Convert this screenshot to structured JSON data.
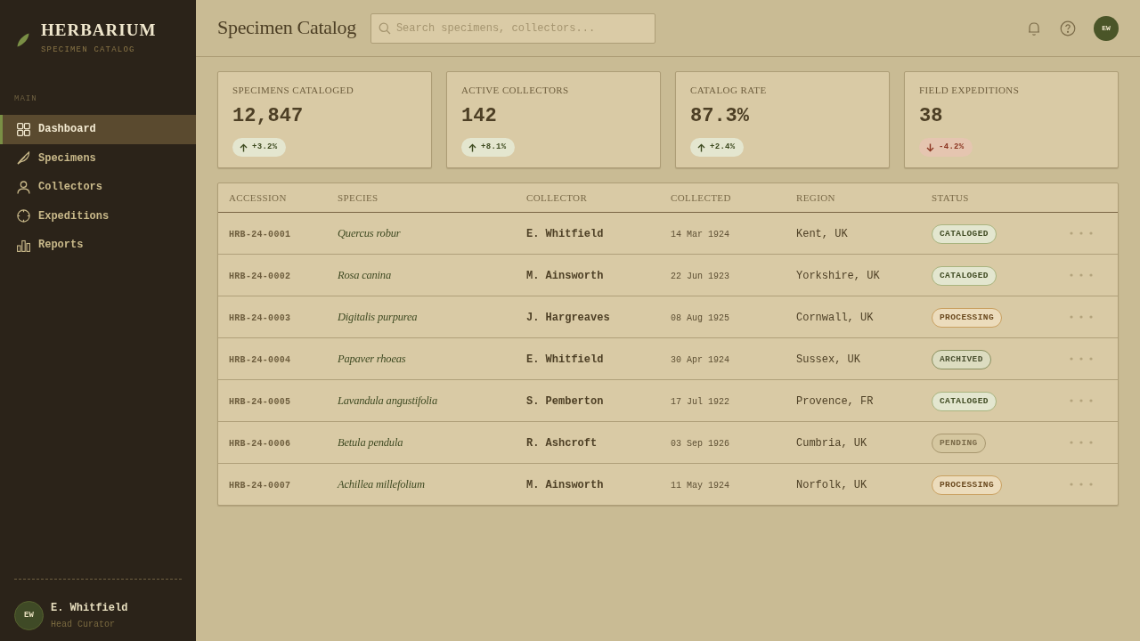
{
  "sidebar": {
    "brand": {
      "title": "HERBARIUM",
      "subtitle": "SPECIMEN CATALOG"
    },
    "section_label": "MAIN",
    "nav": [
      {
        "label": "Dashboard",
        "selected": true
      },
      {
        "label": "Specimens",
        "selected": false
      },
      {
        "label": "Collectors",
        "selected": false
      },
      {
        "label": "Expeditions",
        "selected": false
      },
      {
        "label": "Reports",
        "selected": false
      }
    ],
    "user": {
      "initials": "EW",
      "name": "E. Whitfield",
      "role": "Head Curator"
    }
  },
  "header": {
    "title": "Specimen Catalog",
    "search": {
      "placeholder": "Search specimens, collectors..."
    },
    "avatar": "EW"
  },
  "stats": [
    {
      "label": "SPECIMENS CATALOGED",
      "value": "12,847",
      "change": "+3.2%",
      "kind": "up"
    },
    {
      "label": "ACTIVE COLLECTORS",
      "value": "142",
      "change": "+8.1%",
      "kind": "up"
    },
    {
      "label": "CATALOG RATE",
      "value": "87.3%",
      "change": "+2.4%",
      "kind": "up"
    },
    {
      "label": "FIELD EXPEDITIONS",
      "value": "38",
      "change": "-4.2%",
      "kind": "down"
    }
  ],
  "table": {
    "columns": [
      "ACCESSION",
      "SPECIES",
      "COLLECTOR",
      "COLLECTED",
      "REGION",
      "STATUS"
    ],
    "rows": [
      {
        "accession": "HRB-24-0001",
        "species": "Quercus robur",
        "collector": "E. Whitfield",
        "collected": "14 Mar 1924",
        "region": "Kent, UK",
        "status": {
          "label": "CATALOGED",
          "kind": "cataloged"
        }
      },
      {
        "accession": "HRB-24-0002",
        "species": "Rosa canina",
        "collector": "M. Ainsworth",
        "collected": "22 Jun 1923",
        "region": "Yorkshire, UK",
        "status": {
          "label": "CATALOGED",
          "kind": "cataloged"
        }
      },
      {
        "accession": "HRB-24-0003",
        "species": "Digitalis purpurea",
        "collector": "J. Hargreaves",
        "collected": "08 Aug 1925",
        "region": "Cornwall, UK",
        "status": {
          "label": "PROCESSING",
          "kind": "processing"
        }
      },
      {
        "accession": "HRB-24-0004",
        "species": "Papaver rhoeas",
        "collector": "E. Whitfield",
        "collected": "30 Apr 1924",
        "region": "Sussex, UK",
        "status": {
          "label": "ARCHIVED",
          "kind": "archived"
        }
      },
      {
        "accession": "HRB-24-0005",
        "species": "Lavandula angustifolia",
        "collector": "S. Pemberton",
        "collected": "17 Jul 1922",
        "region": "Provence, FR",
        "status": {
          "label": "CATALOGED",
          "kind": "cataloged"
        }
      },
      {
        "accession": "HRB-24-0006",
        "species": "Betula pendula",
        "collector": "R. Ashcroft",
        "collected": "03 Sep 1926",
        "region": "Cumbria, UK",
        "status": {
          "label": "PENDING",
          "kind": "pending"
        }
      },
      {
        "accession": "HRB-24-0007",
        "species": "Achillea millefolium",
        "collector": "M. Ainsworth",
        "collected": "11 May 1924",
        "region": "Norfolk, UK",
        "status": {
          "label": "PROCESSING",
          "kind": "processing"
        }
      }
    ]
  }
}
